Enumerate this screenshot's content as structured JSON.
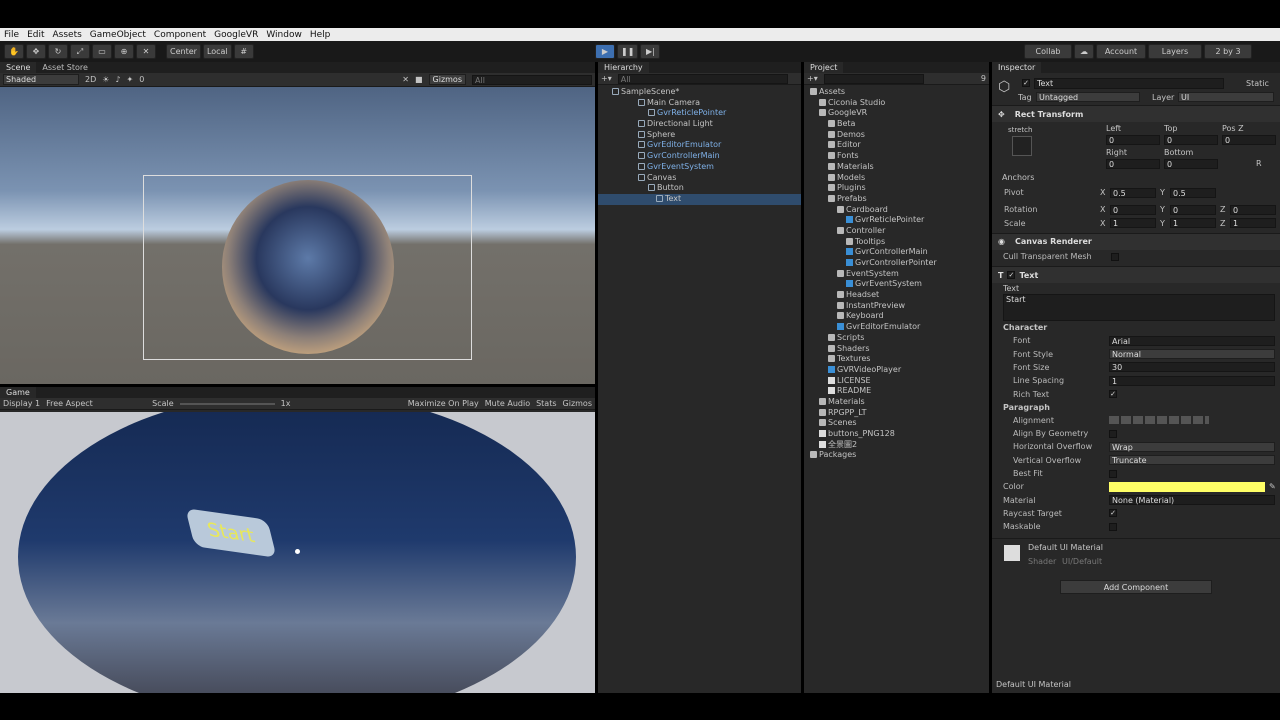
{
  "menu": [
    "File",
    "Edit",
    "Assets",
    "GameObject",
    "Component",
    "GoogleVR",
    "Window",
    "Help"
  ],
  "toolbar": {
    "center": "Center",
    "local": "Local",
    "collab": "Collab",
    "account": "Account",
    "layers": "Layers",
    "layout": "2 by 3"
  },
  "scene": {
    "tab": "Scene",
    "store_tab": "Asset Store",
    "shading": "Shaded",
    "mode2d": "2D",
    "gizmos": "Gizmos",
    "search": "All",
    "hidden_count": "0"
  },
  "game": {
    "tab": "Game",
    "display": "Display 1",
    "aspect": "Free Aspect",
    "scale_label": "Scale",
    "scale_value": "1x",
    "maximize": "Maximize On Play",
    "mute": "Mute Audio",
    "stats": "Stats",
    "gizmos": "Gizmos",
    "button_text": "Start"
  },
  "hierarchy": {
    "tab": "Hierarchy",
    "search": "All",
    "items": [
      "SampleScene*",
      "Main Camera",
      "GvrReticlePointer",
      "Directional Light",
      "Sphere",
      "GvrEditorEmulator",
      "GvrControllerMain",
      "GvrEventSystem",
      "Canvas",
      "Button",
      "Text"
    ]
  },
  "project": {
    "tab": "Project",
    "badge": "9",
    "items": [
      "Assets",
      "Ciconia Studio",
      "GoogleVR",
      "Beta",
      "Demos",
      "Editor",
      "Fonts",
      "Materials",
      "Models",
      "Plugins",
      "Prefabs",
      "Cardboard",
      "GvrReticlePointer",
      "Controller",
      "Tooltips",
      "GvrControllerMain",
      "GvrControllerPointer",
      "EventSystem",
      "GvrEventSystem",
      "Headset",
      "InstantPreview",
      "Keyboard",
      "GvrEditorEmulator",
      "Scripts",
      "Shaders",
      "Textures",
      "GVRVideoPlayer",
      "LICENSE",
      "README",
      "Materials",
      "RPGPP_LT",
      "Scenes",
      "buttons_PNG128",
      "全景圖2",
      "Packages"
    ]
  },
  "inspector": {
    "tab": "Inspector",
    "name": "Text",
    "static": "Static",
    "tag_label": "Tag",
    "tag": "Untagged",
    "layer_label": "Layer",
    "layer": "UI",
    "rect": {
      "title": "Rect Transform",
      "stretch": "stretch",
      "left_l": "Left",
      "left": "0",
      "top_l": "Top",
      "top": "0",
      "posz_l": "Pos Z",
      "posz": "0",
      "right_l": "Right",
      "right": "0",
      "bottom_l": "Bottom",
      "bottom": "0",
      "anchors": "Anchors",
      "pivot": "Pivot",
      "pivot_x": "0.5",
      "pivot_y": "0.5",
      "rotation": "Rotation",
      "rot_x": "0",
      "rot_y": "0",
      "rot_z": "0",
      "scale": "Scale",
      "sc_x": "1",
      "sc_y": "1",
      "sc_z": "1",
      "x": "X",
      "y": "Y",
      "z": "Z",
      "r": "R"
    },
    "canvas_renderer": {
      "title": "Canvas Renderer",
      "cull": "Cull Transparent Mesh"
    },
    "text": {
      "title": "Text",
      "text_label": "Text",
      "text_value": "Start",
      "character": "Character",
      "font_l": "Font",
      "font": "Arial",
      "style_l": "Font Style",
      "style": "Normal",
      "size_l": "Font Size",
      "size": "30",
      "spacing_l": "Line Spacing",
      "spacing": "1",
      "rich_l": "Rich Text",
      "paragraph": "Paragraph",
      "align_l": "Alignment",
      "geom_l": "Align By Geometry",
      "hover_l": "Horizontal Overflow",
      "hover": "Wrap",
      "vover_l": "Vertical Overflow",
      "vover": "Truncate",
      "bestfit_l": "Best Fit",
      "color_l": "Color",
      "color": "#ffff66",
      "material_l": "Material",
      "material": "None (Material)",
      "raycast_l": "Raycast Target",
      "maskable_l": "Maskable"
    },
    "material": {
      "title": "Default UI Material",
      "shader_l": "Shader",
      "shader": "UI/Default"
    },
    "add_component": "Add Component",
    "footer": "Default UI Material"
  }
}
